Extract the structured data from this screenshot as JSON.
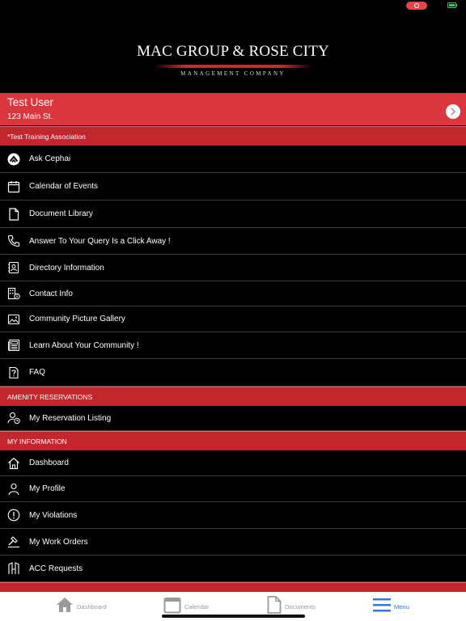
{
  "brand": {
    "main": "MAC GROUP & ROSE CITY",
    "sub": "MANAGEMENT COMPANY"
  },
  "user": {
    "name": "Test User",
    "address": "123 Main St."
  },
  "sections": {
    "association": "*Test Training Association",
    "amenity": "AMENITY RESERVATIONS",
    "my_info": "MY INFORMATION"
  },
  "association_items": [
    {
      "label": "Ask Cephai",
      "icon": "cephai-icon"
    },
    {
      "label": "Calendar of Events",
      "icon": "calendar-icon"
    },
    {
      "label": "Document Library",
      "icon": "document-icon"
    },
    {
      "label": "Answer To Your Query Is a Click Away !",
      "icon": "phone-icon"
    },
    {
      "label": "Directory Information",
      "icon": "contact-card-icon"
    },
    {
      "label": "Contact Info",
      "icon": "building-info-icon"
    },
    {
      "label": "Community Picture Gallery",
      "icon": "image-icon"
    },
    {
      "label": "Learn About Your Community !",
      "icon": "newspaper-icon"
    },
    {
      "label": "FAQ",
      "icon": "faq-icon"
    }
  ],
  "amenity_items": [
    {
      "label": "My Reservation Listing",
      "icon": "user-clock-icon"
    }
  ],
  "my_info_items": [
    {
      "label": "Dashboard",
      "icon": "home-icon"
    },
    {
      "label": "My Profile",
      "icon": "user-icon"
    },
    {
      "label": "My Violations",
      "icon": "alert-icon"
    },
    {
      "label": "My Work Orders",
      "icon": "hammer-icon"
    },
    {
      "label": "ACC Requests",
      "icon": "door-icon"
    }
  ],
  "tabs": [
    {
      "label": "Dashboard",
      "icon": "home-icon"
    },
    {
      "label": "Calendar",
      "icon": "calendar-icon"
    },
    {
      "label": "Documents",
      "icon": "document-icon"
    },
    {
      "label": "Menu",
      "icon": "menu-icon"
    }
  ],
  "colors": {
    "accent_red": "#d9363e",
    "section_red": "#c4262d",
    "tab_active": "#3b76d6"
  }
}
